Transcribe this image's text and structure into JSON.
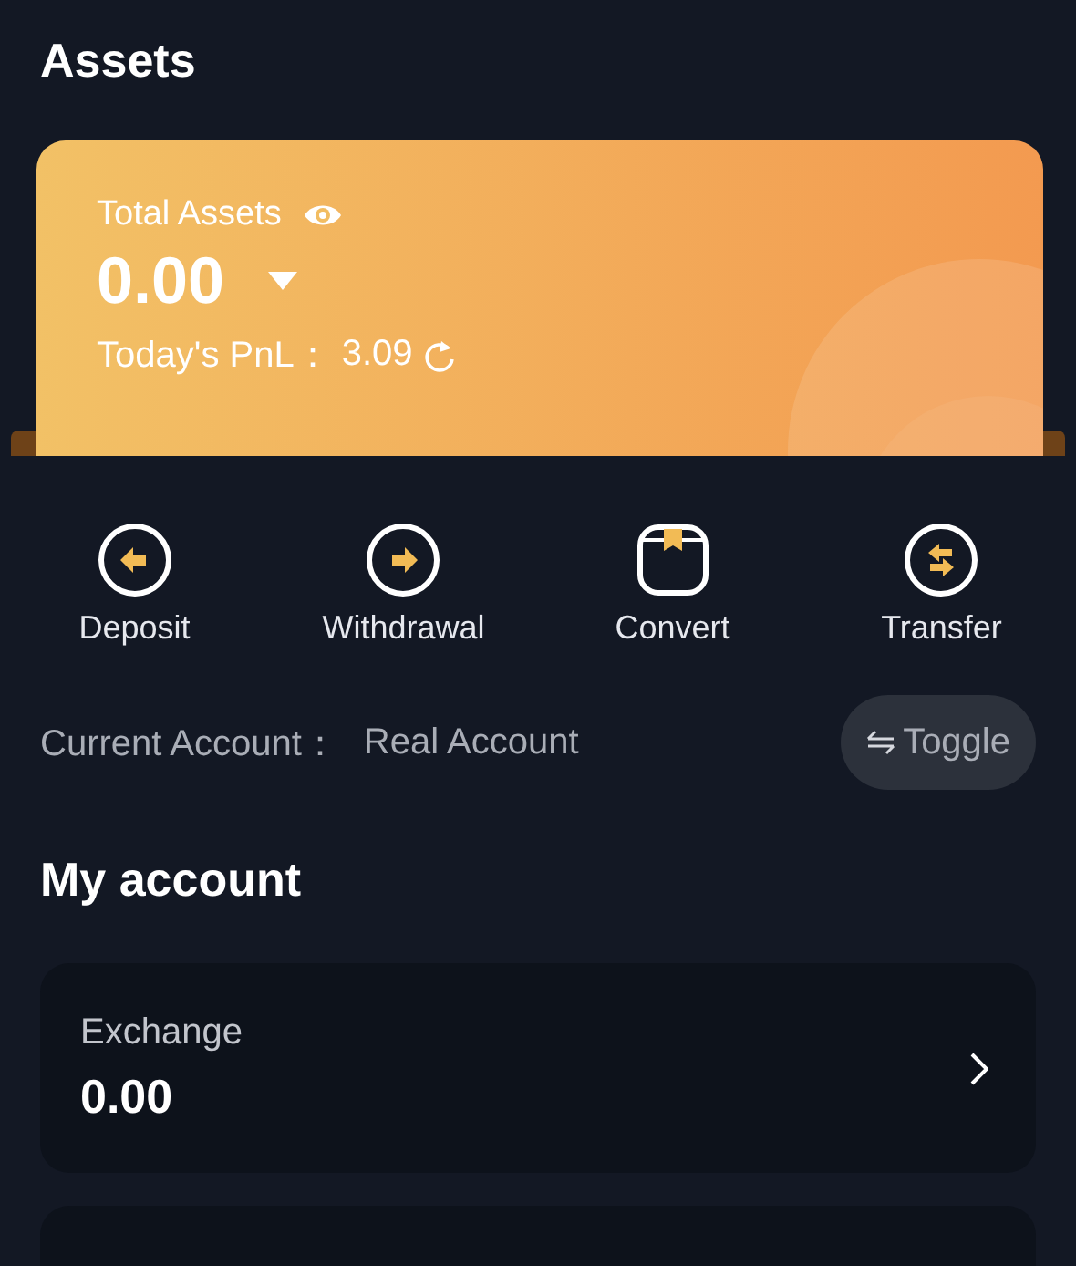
{
  "header": {
    "title": "Assets"
  },
  "summary": {
    "label": "Total Assets",
    "amount": "0.00",
    "pnl_label": "Today's PnL：",
    "pnl_value": "3.09"
  },
  "actions": [
    {
      "label": "Deposit"
    },
    {
      "label": "Withdrawal"
    },
    {
      "label": "Convert"
    },
    {
      "label": "Transfer"
    }
  ],
  "account": {
    "label": "Current Account：",
    "value": "Real Account",
    "button": "Toggle"
  },
  "section_title": "My account",
  "accounts": [
    {
      "name": "Exchange",
      "balance": "0.00"
    }
  ]
}
